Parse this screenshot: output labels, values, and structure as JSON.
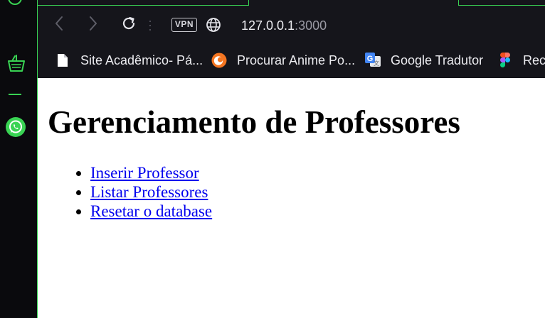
{
  "browser": {
    "vpn_label": "VPN",
    "url_host": "127.0.0.1",
    "url_port": ":3000"
  },
  "bookmarks": [
    {
      "label": "Site Acadêmico- Pá...",
      "icon": "document-icon"
    },
    {
      "label": "Procurar Anime Po...",
      "icon": "crunchyroll-icon"
    },
    {
      "label": "Google Tradutor",
      "icon": "google-translate-icon"
    },
    {
      "label": "Rece",
      "icon": "figma-icon"
    }
  ],
  "page": {
    "heading": "Gerenciamento de Professores",
    "links": [
      "Inserir Professor",
      "Listar Professores",
      "Resetar o database"
    ]
  },
  "colors": {
    "accent": "#39d353",
    "link": "#0000ee",
    "toolbar_bg": "#15151b"
  }
}
